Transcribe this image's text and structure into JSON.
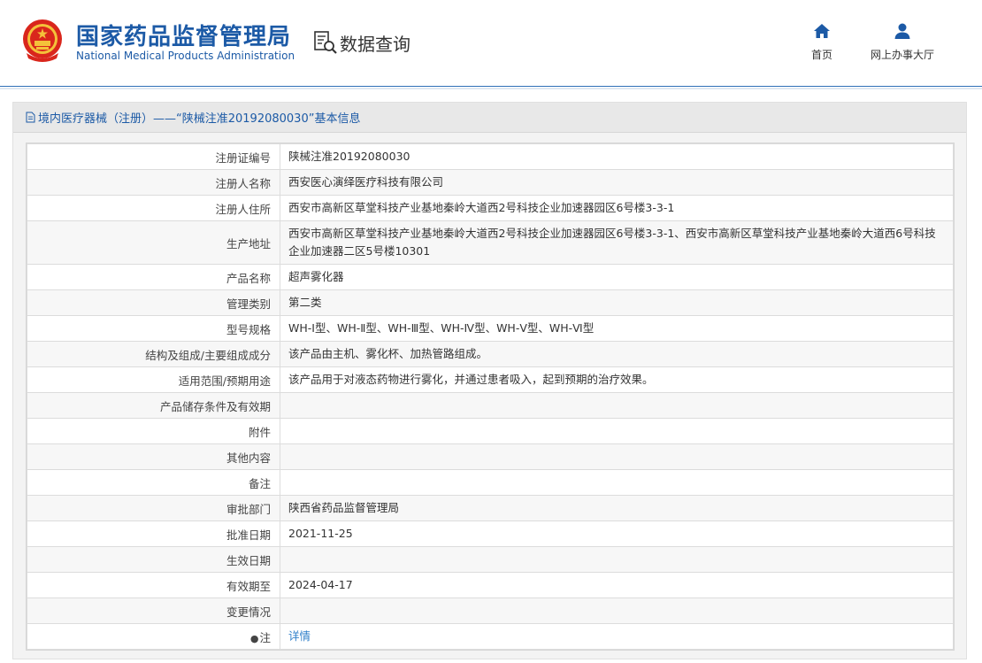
{
  "header": {
    "brand_cn": "国家药品监督管理局",
    "brand_en": "National Medical Products Administration",
    "section_title": "数据查询",
    "nav": [
      {
        "label": "首页",
        "icon": "home-icon"
      },
      {
        "label": "网上办事大厅",
        "icon": "user-icon"
      }
    ],
    "accent_color": "#1c5aa6"
  },
  "panel": {
    "title": "境内医疗器械（注册）——“陕械注准20192080030”基本信息"
  },
  "table": {
    "rows": [
      {
        "key": "注册证编号",
        "value": "陕械注准20192080030"
      },
      {
        "key": "注册人名称",
        "value": "西安医心演绎医疗科技有限公司"
      },
      {
        "key": "注册人住所",
        "value": "西安市高新区草堂科技产业基地秦岭大道西2号科技企业加速器园区6号楼3-3-1"
      },
      {
        "key": "生产地址",
        "value": "西安市高新区草堂科技产业基地秦岭大道西2号科技企业加速器园区6号楼3-3-1、西安市高新区草堂科技产业基地秦岭大道西6号科技企业加速器二区5号楼10301"
      },
      {
        "key": "产品名称",
        "value": "超声雾化器"
      },
      {
        "key": "管理类别",
        "value": "第二类"
      },
      {
        "key": "型号规格",
        "value": "WH-Ⅰ型、WH-Ⅱ型、WH-Ⅲ型、WH-Ⅳ型、WH-Ⅴ型、WH-Ⅵ型"
      },
      {
        "key": "结构及组成/主要组成成分",
        "value": "该产品由主机、雾化杯、加热管路组成。"
      },
      {
        "key": "适用范围/预期用途",
        "value": "该产品用于对液态药物进行雾化，并通过患者吸入，起到预期的治疗效果。"
      },
      {
        "key": "产品储存条件及有效期",
        "value": ""
      },
      {
        "key": "附件",
        "value": ""
      },
      {
        "key": "其他内容",
        "value": ""
      },
      {
        "key": "备注",
        "value": ""
      },
      {
        "key": "审批部门",
        "value": "陕西省药品监督管理局"
      },
      {
        "key": "批准日期",
        "value": "2021-11-25"
      },
      {
        "key": "生效日期",
        "value": ""
      },
      {
        "key": "有效期至",
        "value": "2024-04-17"
      },
      {
        "key": "变更情况",
        "value": ""
      }
    ],
    "note_label": "注",
    "note_link": "详情"
  }
}
